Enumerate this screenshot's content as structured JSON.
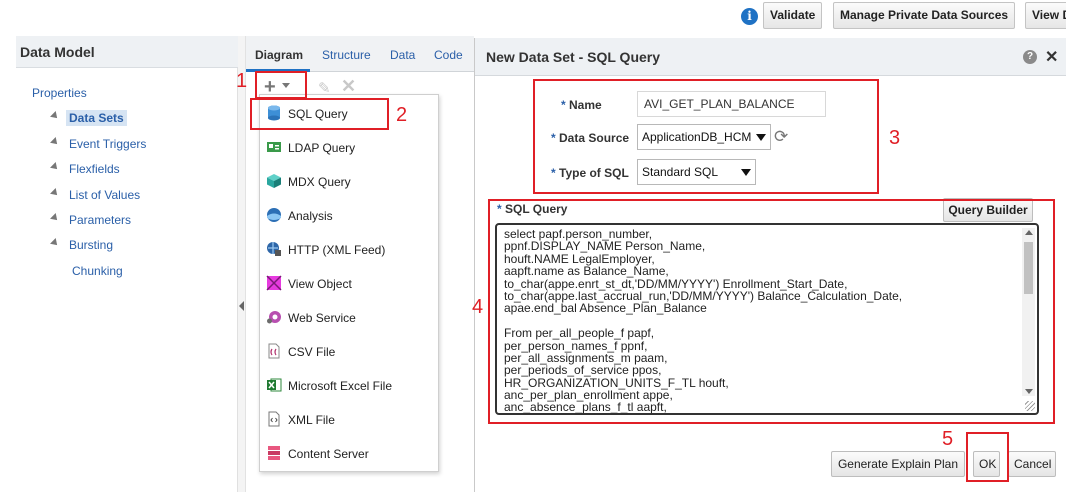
{
  "toolbar": {
    "validate_label": "Validate",
    "manage_label": "Manage Private Data Sources",
    "view_label": "View D"
  },
  "left_pane": {
    "title": "Data Model",
    "items": [
      {
        "label": "Properties"
      },
      {
        "label": "Data Sets"
      },
      {
        "label": "Event Triggers"
      },
      {
        "label": "Flexfields"
      },
      {
        "label": "List of Values"
      },
      {
        "label": "Parameters"
      },
      {
        "label": "Bursting"
      },
      {
        "label": "Chunking"
      }
    ]
  },
  "mid_pane": {
    "tabs": [
      "Diagram",
      "Structure",
      "Data",
      "Code"
    ],
    "menu": [
      {
        "label": "SQL Query",
        "icon": "database-icon"
      },
      {
        "label": "LDAP Query",
        "icon": "ldap-icon"
      },
      {
        "label": "MDX Query",
        "icon": "cube-icon"
      },
      {
        "label": "Analysis",
        "icon": "analysis-icon"
      },
      {
        "label": "HTTP (XML Feed)",
        "icon": "http-icon"
      },
      {
        "label": "View Object",
        "icon": "view-object-icon"
      },
      {
        "label": "Web Service",
        "icon": "web-service-icon"
      },
      {
        "label": "CSV File",
        "icon": "csv-file-icon"
      },
      {
        "label": "Microsoft Excel File",
        "icon": "excel-file-icon"
      },
      {
        "label": "XML File",
        "icon": "xml-file-icon"
      },
      {
        "label": "Content Server",
        "icon": "content-server-icon"
      }
    ]
  },
  "dialog": {
    "title": "New Data Set - SQL Query",
    "name_label": "Name",
    "name_value": "AVI_GET_PLAN_BALANCE",
    "datasource_label": "Data Source",
    "datasource_value": "ApplicationDB_HCM",
    "sqltype_label": "Type of SQL",
    "sqltype_value": "Standard SQL",
    "required_mark": "*",
    "sql_label": "SQL Query",
    "query_builder_label": "Query Builder",
    "sql_lines": [
      "select papf.person_number,",
      "ppnf.DISPLAY_NAME Person_Name,",
      "houft.NAME LegalEmployer,",
      "aapft.name as Balance_Name,",
      "to_char(appe.enrt_st_dt,'DD/MM/YYYY') Enrollment_Start_Date,",
      "to_char(appe.last_accrual_run,'DD/MM/YYYY') Balance_Calculation_Date,",
      "apae.end_bal Absence_Plan_Balance",
      "",
      "From per_all_people_f papf,",
      "per_person_names_f ppnf,",
      "per_all_assignments_m paam,",
      "per_periods_of_service ppos,",
      "HR_ORGANIZATION_UNITS_F_TL houft,",
      "anc_per_plan_enrollment appe,",
      "anc_absence_plans_f_tl aapft,"
    ],
    "explain_label": "Generate Explain Plan",
    "ok_label": "OK",
    "cancel_label": "Cancel"
  },
  "annotations": {
    "n1": "1",
    "n2": "2",
    "n3": "3",
    "n4": "4",
    "n5": "5",
    "color": "#e01f26"
  }
}
